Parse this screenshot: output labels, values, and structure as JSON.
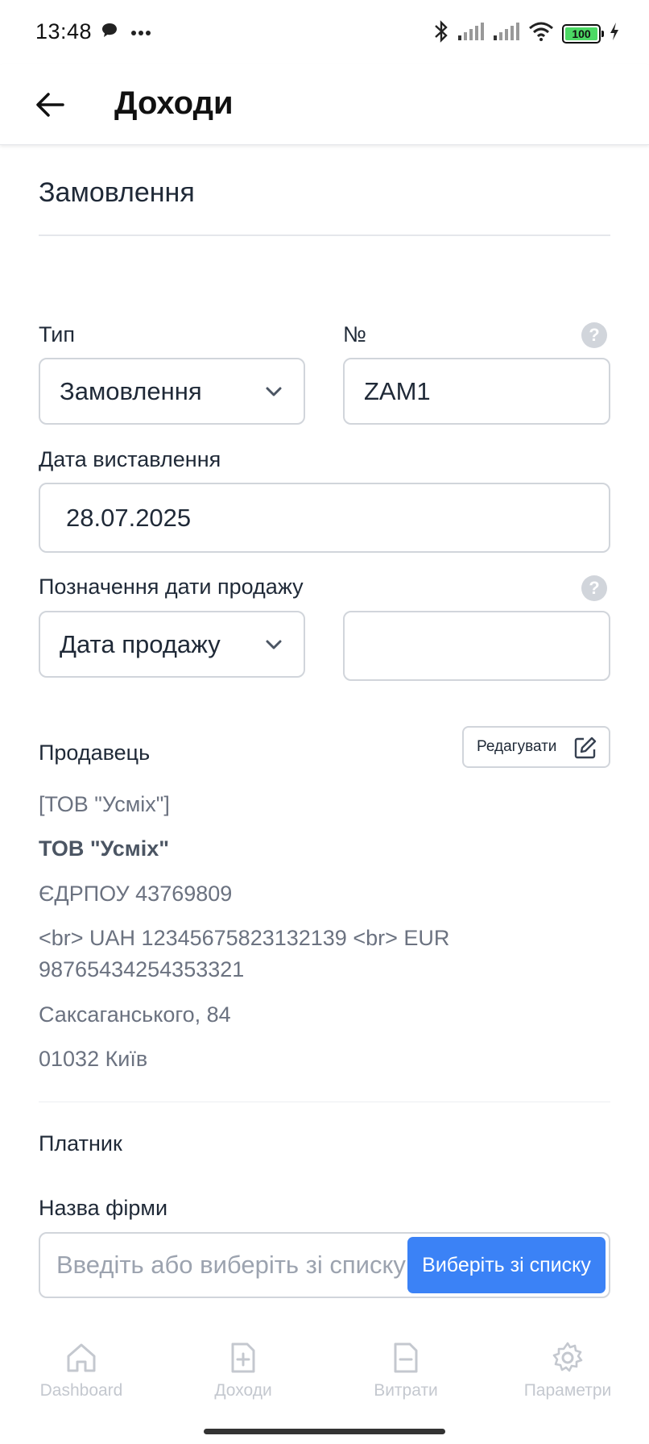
{
  "status_bar": {
    "time": "13:48",
    "battery": "100"
  },
  "app_bar": {
    "title": "Доходи"
  },
  "section": {
    "title": "Замовлення"
  },
  "form": {
    "type_label": "Тип",
    "type_value": "Замовлення",
    "number_label": "№",
    "number_value": "ZAM1",
    "issue_date_label": "Дата виставлення",
    "issue_date_value": "28.07.2025",
    "sale_date_label": "Позначення дати продажу",
    "sale_date_select_value": "Дата продажу",
    "sale_date_value": ""
  },
  "seller": {
    "title": "Продавець",
    "edit_label": "Редагувати",
    "lines": [
      "[ТОВ \"Усміх\"]",
      "ТОВ \"Усміх\"",
      "ЄДРПОУ 43769809",
      "<br> UAH 12345675823132139 <br> EUR 98765434254353321",
      "Саксаганського, 84",
      "01032 Київ"
    ]
  },
  "payer": {
    "title": "Платник",
    "company_label": "Назва фірми",
    "company_placeholder": "Введіть або виберіть зі списку",
    "select_button": "Виберіть зі списку"
  },
  "bottom_nav": {
    "items": [
      {
        "label": "Dashboard",
        "icon": "home-icon"
      },
      {
        "label": "Доходи",
        "icon": "file-plus-icon"
      },
      {
        "label": "Витрати",
        "icon": "file-minus-icon"
      },
      {
        "label": "Параметри",
        "icon": "gear-icon"
      }
    ]
  },
  "colors": {
    "accent": "#3b82f6",
    "battery": "#4cd964"
  }
}
